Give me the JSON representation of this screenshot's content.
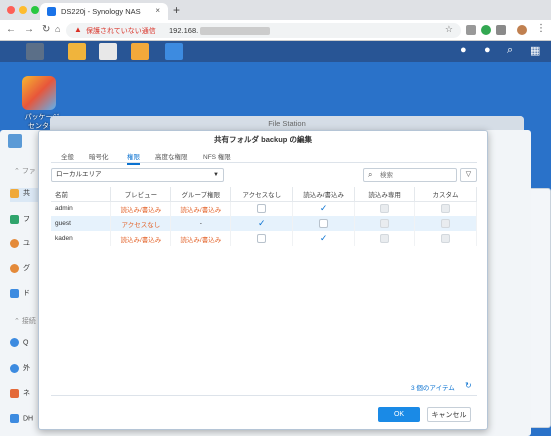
{
  "browser": {
    "tab_title": "DS220j - Synology NAS",
    "tab_close": "×",
    "new_tab": "+",
    "security_warning": "保護されていない通信",
    "url": "192.168."
  },
  "desktop": {
    "icon_label_line1": "パッケージ",
    "icon_label_line2": "センター"
  },
  "file_station": {
    "title": "File Station"
  },
  "control_panel": {
    "sidebar": [
      {
        "label": "ファ"
      },
      {
        "label": "共"
      },
      {
        "label": "フ"
      },
      {
        "label": "ユ"
      },
      {
        "label": "グ"
      },
      {
        "label": "ド"
      },
      {
        "label": "接続"
      },
      {
        "label": "Q"
      },
      {
        "label": "外"
      },
      {
        "label": "ネ"
      },
      {
        "label": "DH"
      }
    ]
  },
  "dialog": {
    "title": "共有フォルダ backup の編集",
    "tabs": [
      "全般",
      "暗号化",
      "権限",
      "高度な権限",
      "NFS 権限"
    ],
    "active_tab": "権限",
    "scope_select": "ローカルエリア",
    "search_placeholder": "検索",
    "columns": [
      "名前",
      "プレビュー",
      "グループ権限",
      "アクセスなし",
      "読込み/書込み",
      "読込み専用",
      "カスタム"
    ],
    "rows": [
      {
        "name": "admin",
        "preview": "読込み/書込み",
        "group": "読込み/書込み",
        "no_access": false,
        "read_write": true,
        "read_only": false,
        "custom": false
      },
      {
        "name": "guest",
        "preview": "アクセスなし",
        "group": "-",
        "no_access": true,
        "read_write": false,
        "read_only": false,
        "custom": false
      },
      {
        "name": "kaden",
        "preview": "読込み/書込み",
        "group": "読込み/書込み",
        "no_access": false,
        "read_write": true,
        "read_only": false,
        "custom": false
      }
    ],
    "item_count": "3 個のアイテム",
    "ok_label": "OK",
    "cancel_label": "キャンセル"
  },
  "colors": {
    "accent": "#0a72d1",
    "permission_text": "#e3632a",
    "desktop_bg": "#2a72c9"
  }
}
